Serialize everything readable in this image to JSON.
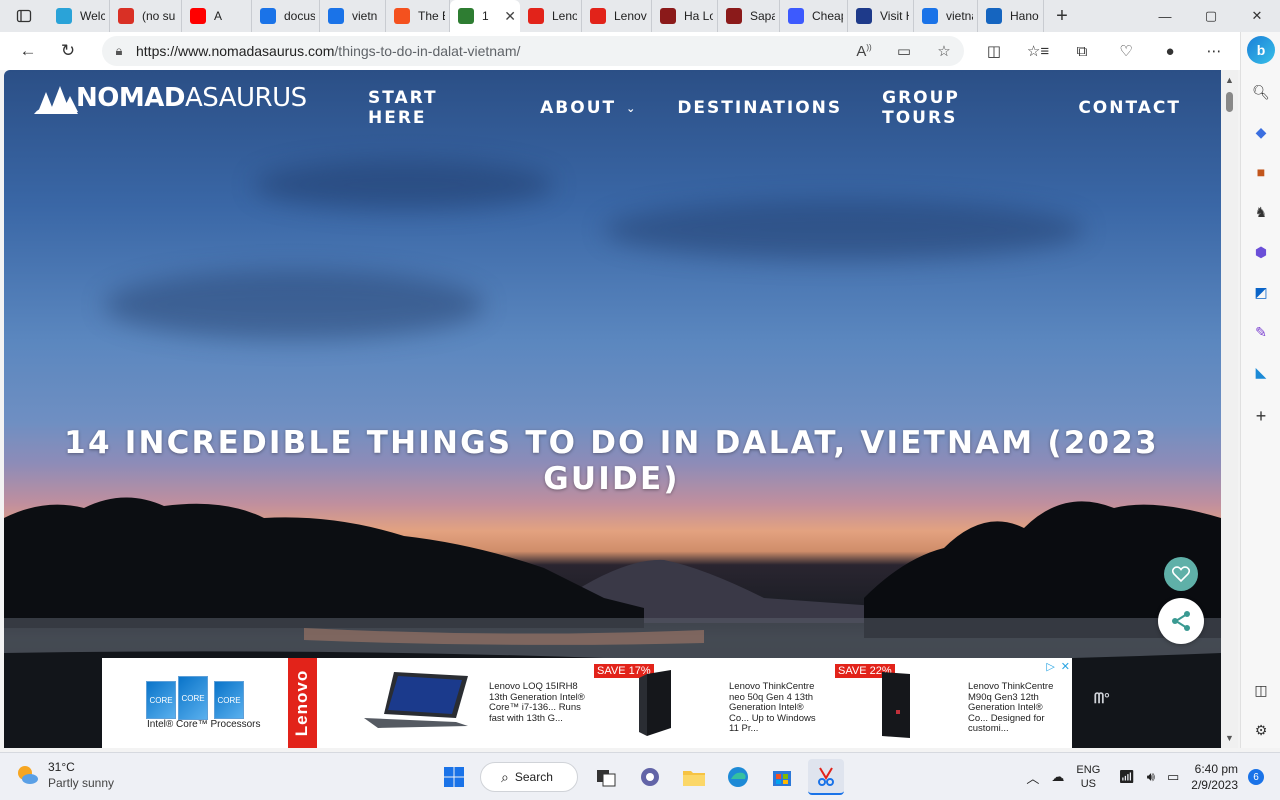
{
  "browser": {
    "tabs": [
      {
        "title": "Welco",
        "favicon": "edge-icon",
        "color": "#2aa3d8"
      },
      {
        "title": "(no su",
        "favicon": "gmail-icon",
        "color": "#d93025"
      },
      {
        "title": "A",
        "favicon": "youtube-icon",
        "color": "#ff0000"
      },
      {
        "title": "docus",
        "favicon": "search-icon",
        "color": "#1a73e8"
      },
      {
        "title": "vietn",
        "favicon": "search-icon",
        "color": "#1a73e8"
      },
      {
        "title": "The B",
        "favicon": "g-icon",
        "color": "#f4511e"
      },
      {
        "title": "1",
        "favicon": "nomadasaurus-icon",
        "color": "#2e7d32",
        "active": true
      },
      {
        "title": "Lenov",
        "favicon": "lenovo-icon",
        "color": "#e2231a"
      },
      {
        "title": "Lenov",
        "favicon": "lenovo-icon",
        "color": "#e2231a"
      },
      {
        "title": "Ha Lo",
        "favicon": "hotel-icon",
        "color": "#8b1a1a"
      },
      {
        "title": "Sapa",
        "favicon": "hotel-icon",
        "color": "#8b1a1a"
      },
      {
        "title": "Cheap",
        "favicon": "t-icon",
        "color": "#3d5afe"
      },
      {
        "title": "Visit H",
        "favicon": "v-icon",
        "color": "#1e3a8a"
      },
      {
        "title": "vietna",
        "favicon": "search-icon",
        "color": "#1a73e8"
      },
      {
        "title": "Hanoi",
        "favicon": "lp-icon",
        "color": "#1565c0"
      }
    ],
    "url_host": "https://www.nomadasaurus.com",
    "url_path": "/things-to-do-in-dalat-vietnam/"
  },
  "site": {
    "logo_bold": "NOMAD",
    "logo_light": "ASAURUS",
    "nav": [
      "START HERE",
      "ABOUT",
      "DESTINATIONS",
      "GROUP TOURS",
      "CONTACT"
    ],
    "hero_title": "14 INCREDIBLE THINGS TO DO IN DALAT, VIETNAM (2023 GUIDE)"
  },
  "ad": {
    "intel_chips": [
      "CORE",
      "CORE",
      "CORE"
    ],
    "intel_caption": "Intel® Core™ Processors",
    "brand": "Lenovo",
    "products": [
      {
        "text": "Lenovo LOQ 15IRH8 13th Generation Intel® Core™ i7-136... Runs fast with 13th G..."
      },
      {
        "text": "Lenovo ThinkCentre neo 50q Gen 4 13th Generation Intel® Co... Up to Windows 11 Pr...",
        "save": "SAVE 17%"
      },
      {
        "text": "Lenovo ThinkCentre M90q Gen3 12th Generation Intel® Co... Designed for customi...",
        "save": "SAVE 22%"
      }
    ]
  },
  "taskbar": {
    "temp": "31°C",
    "condition": "Partly sunny",
    "search_label": "Search",
    "lang_1": "ENG",
    "lang_2": "US",
    "time": "6:40 pm",
    "date": "2/9/2023",
    "notifications": "6"
  }
}
